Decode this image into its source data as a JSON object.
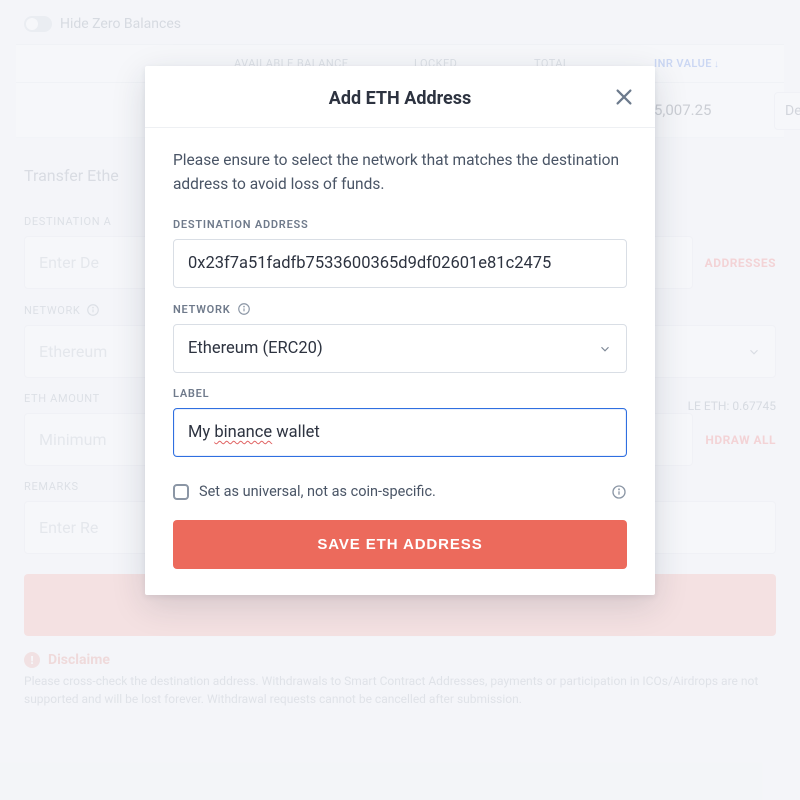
{
  "header": {
    "hide_zero_label": "Hide Zero Balances",
    "cols": {
      "available": "AVAILABLE BALANCE",
      "locked": "LOCKED",
      "total": "TOTAL",
      "inr": "INR VALUE",
      "sort_arrow": "↓"
    }
  },
  "row": {
    "inr_value": "5,007.25",
    "action": "De"
  },
  "transfer": {
    "section_title": "Transfer Ethe",
    "dest_label": "DESTINATION A",
    "dest_placeholder": "Enter De",
    "addresses_link": "ADDRESSES",
    "network_label": "NETWORK",
    "network_value": "Ethereum",
    "amount_label": "ETH AMOUNT",
    "amount_placeholder": "Minimum",
    "available_eth": "LE ETH: 0.67745",
    "withdraw_all": "HDRAW ALL",
    "remarks_label": "REMARKS",
    "remarks_placeholder": "Enter Re"
  },
  "disclaimer": {
    "title": "Disclaime",
    "body": "Please cross-check the destination address. Withdrawals to Smart Contract Addresses, payments or participation in ICOs/Airdrops are not supported and will be lost forever. Withdrawal requests cannot be cancelled after submission."
  },
  "modal": {
    "title": "Add ETH Address",
    "msg": "Please ensure to select the network that matches the destination address to avoid loss of funds.",
    "dest_label": "DESTINATION ADDRESS",
    "dest_value": "0x23f7a51fadfb7533600365d9df02601e81c2475",
    "network_label": "NETWORK",
    "network_value": "Ethereum (ERC20)",
    "label_label": "LABEL",
    "label_value_plain": "My binance wallet",
    "universal_text": "Set as universal, not as coin-specific.",
    "save_btn": "SAVE ETH ADDRESS"
  }
}
